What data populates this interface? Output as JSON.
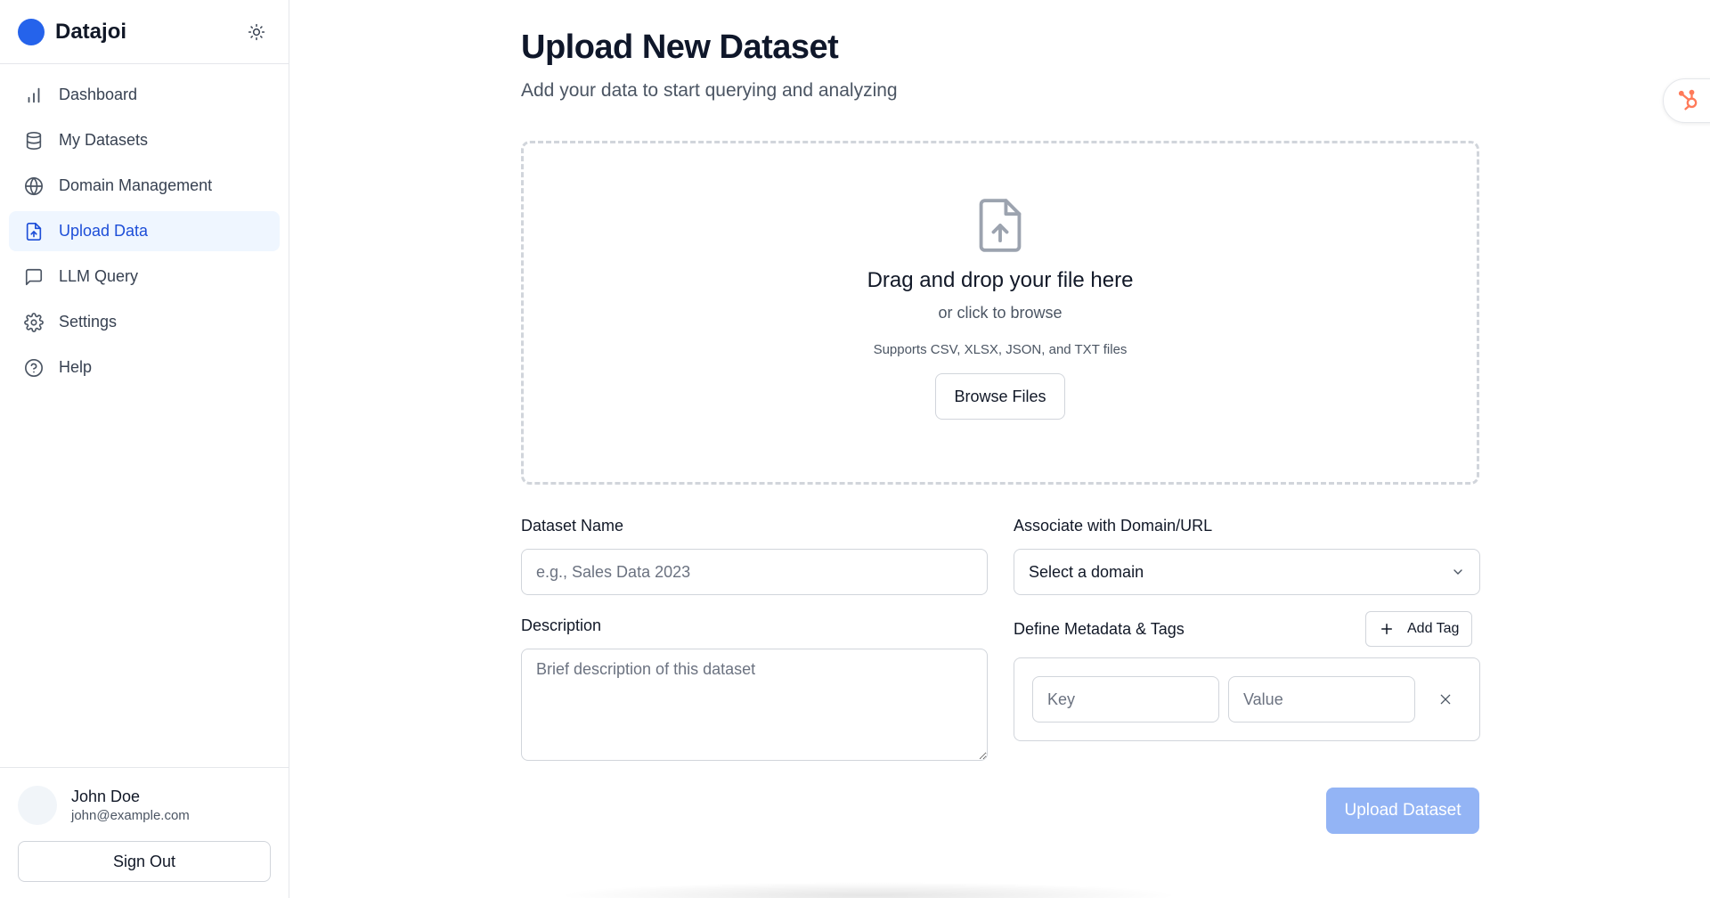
{
  "brand": {
    "name": "Datajoi",
    "accent": "#2563eb"
  },
  "sidebar": {
    "items": [
      {
        "label": "Dashboard",
        "icon": "bar-chart-icon"
      },
      {
        "label": "My Datasets",
        "icon": "database-icon"
      },
      {
        "label": "Domain Management",
        "icon": "globe-icon"
      },
      {
        "label": "Upload Data",
        "icon": "file-upload-icon",
        "active": true
      },
      {
        "label": "LLM Query",
        "icon": "message-square-icon"
      },
      {
        "label": "Settings",
        "icon": "gear-icon"
      },
      {
        "label": "Help",
        "icon": "help-circle-icon"
      }
    ]
  },
  "user": {
    "name": "John Doe",
    "email": "john@example.com",
    "signout_label": "Sign Out"
  },
  "page": {
    "title": "Upload New Dataset",
    "subtitle": "Add your data to start querying and analyzing"
  },
  "dropzone": {
    "title": "Drag and drop your file here",
    "subtitle": "or click to browse",
    "support": "Supports CSV, XLSX, JSON, and TXT files",
    "browse_label": "Browse Files"
  },
  "form": {
    "dataset_name": {
      "label": "Dataset Name",
      "placeholder": "e.g., Sales Data 2023",
      "value": ""
    },
    "domain": {
      "label": "Associate with Domain/URL",
      "selected": "Select a domain"
    },
    "description": {
      "label": "Description",
      "placeholder": "Brief description of this dataset",
      "value": ""
    },
    "metadata": {
      "label": "Define Metadata & Tags",
      "add_label": "Add Tag",
      "key_placeholder": "Key",
      "value_placeholder": "Value"
    },
    "submit_label": "Upload Dataset",
    "submit_color": "#93b4f5"
  }
}
